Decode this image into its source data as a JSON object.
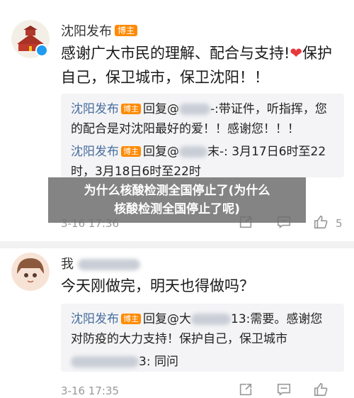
{
  "comment1": {
    "username": "沈阳发布",
    "badge": "博主",
    "text_a": "感谢广大市民的理解、配合与支持!",
    "heart": "❤",
    "text_b": "保护自己，保卫城市，保卫沈阳！！",
    "replies": [
      {
        "name": "沈阳发布",
        "badge": "博主",
        "prefix": "回复@",
        "text": "-:带证件，听指挥，您的配合是对沈阳最好的爱！！感谢您！！！"
      },
      {
        "name": "沈阳发布",
        "badge": "博主",
        "prefix": "回复@",
        "text": "末-: 3月17日6时至22时，3月18日6时至22时"
      }
    ],
    "time": "3-16 17:36",
    "likes": "5"
  },
  "comment2": {
    "username": "我",
    "text": "今天刚做完，明天也得做吗？",
    "replies": [
      {
        "name": "沈阳发布",
        "badge": "博主",
        "prefix": "回复@大",
        "text": "13:需要。感谢您对防疫的大力支持！保护自己，保卫城市"
      },
      {
        "name": "",
        "badge": "",
        "prefix": "",
        "text": "3: 同问"
      }
    ],
    "time": "3-16 17:35"
  },
  "overlay": {
    "line1": "为什么核酸检测全国停止了(为什么",
    "line2": "核酸检测全国停止了呢)"
  },
  "colors": {
    "badge": "#ff8a00",
    "link": "#486e9e",
    "heart": "#e8363a"
  }
}
